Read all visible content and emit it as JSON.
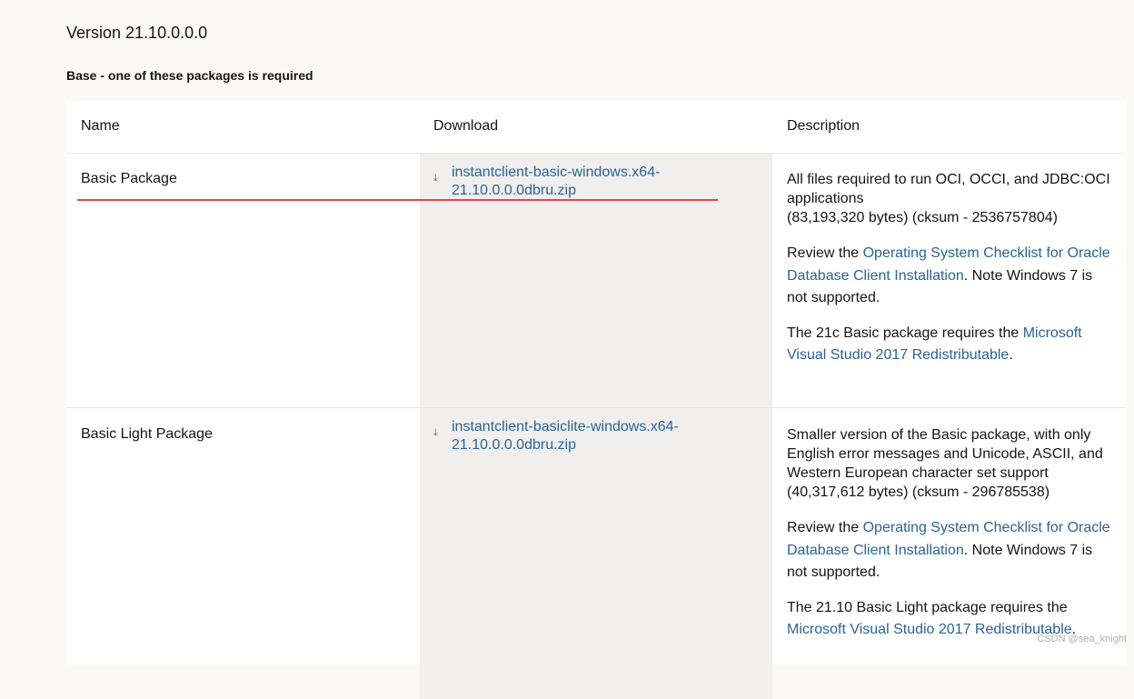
{
  "version": "Version 21.10.0.0.0",
  "section_title": "Base - one of these packages is required",
  "table": {
    "headers": [
      "Name",
      "Download",
      "Description"
    ],
    "rows": [
      {
        "name": "Basic Package",
        "download_line1": "instantclient-basic-windows.x64-",
        "download_line2": "21.10.0.0.0dbru.zip",
        "desc_p1_line1": "All files required to run OCI, OCCI, and JDBC:OCI",
        "desc_p1_line2": "applications",
        "desc_p1_line3": "(83,193,320 bytes) (cksum - 2536757804)",
        "desc_p2_pre": "Review the ",
        "desc_p2_link": "Operating System Checklist for Oracle Database Client Installation",
        "desc_p2_post": ". Note Windows 7 is not supported.",
        "desc_p3_pre": "The 21c Basic package requires the ",
        "desc_p3_link": "Microsoft Visual Studio 2017 Redistributable",
        "desc_p3_post": "."
      },
      {
        "name": "Basic Light Package",
        "download_line1": "instantclient-basiclite-windows.x64-",
        "download_line2": "21.10.0.0.0dbru.zip",
        "desc_p1_line1": "Smaller version of the Basic package, with only",
        "desc_p1_line2": "English error messages and Unicode, ASCII, and",
        "desc_p1_line3": "Western European character set support",
        "desc_p1_line4": "(40,317,612 bytes) (cksum - 296785538)",
        "desc_p2_pre": "Review the ",
        "desc_p2_link": "Operating System Checklist for Oracle Database Client Installation",
        "desc_p2_post": ". Note Windows 7 is not supported.",
        "desc_p3_pre": "The 21.10 Basic Light package requires the ",
        "desc_p3_link": "Microsoft Visual Studio 2017 Redistributable",
        "desc_p3_post": "."
      }
    ]
  },
  "icons": {
    "download": "download-icon"
  },
  "colors": {
    "link": "#2a6496",
    "highlight_line": "#e84646",
    "shade": "#f0efee"
  },
  "watermark": "CSDN @sea_knight"
}
